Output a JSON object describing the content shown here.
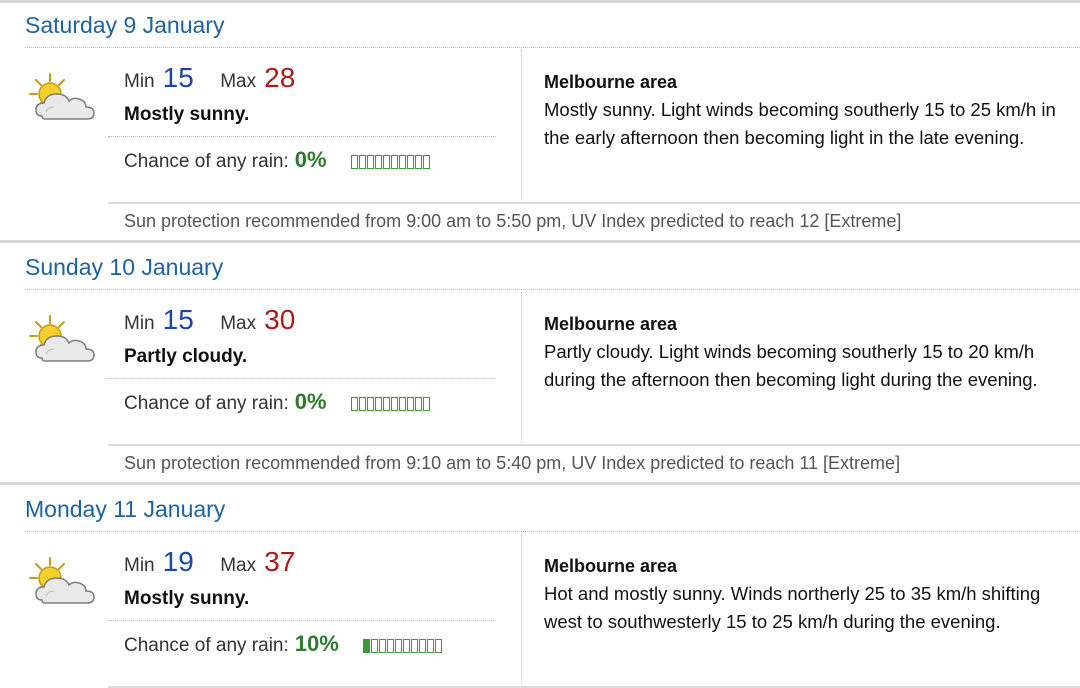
{
  "days": [
    {
      "heading": "Saturday 9 January",
      "min_label": "Min",
      "min": "15",
      "max_label": "Max",
      "max": "28",
      "summary": "Mostly sunny.",
      "rain_label": "Chance of any rain:",
      "rain_value": "0%",
      "rain_fraction": 0.0,
      "area_title": "Melbourne area",
      "area_text": "Mostly sunny. Light winds becoming southerly 15 to 25 km/h in the early afternoon then becoming light in the late evening.",
      "uv": "Sun protection recommended from 9:00 am to 5:50 pm, UV Index predicted to reach 12 [Extreme]",
      "icon": "partly-sunny-icon"
    },
    {
      "heading": "Sunday 10 January",
      "min_label": "Min",
      "min": "15",
      "max_label": "Max",
      "max": "30",
      "summary": "Partly cloudy.",
      "rain_label": "Chance of any rain:",
      "rain_value": "0%",
      "rain_fraction": 0.0,
      "area_title": "Melbourne area",
      "area_text": "Partly cloudy. Light winds becoming southerly 15 to 20 km/h during the afternoon then becoming light during the evening.",
      "uv": "Sun protection recommended from 9:10 am to 5:40 pm, UV Index predicted to reach 11 [Extreme]",
      "icon": "partly-sunny-icon"
    },
    {
      "heading": "Monday 11 January",
      "min_label": "Min",
      "min": "19",
      "max_label": "Max",
      "max": "37",
      "summary": "Mostly sunny.",
      "rain_label": "Chance of any rain:",
      "rain_value": "10%",
      "rain_fraction": 0.1,
      "area_title": "Melbourne area",
      "area_text": "Hot and mostly sunny. Winds northerly 25 to 35 km/h shifting west to southwesterly 15 to 25 km/h during the evening.",
      "icon": "partly-sunny-icon"
    }
  ],
  "colors": {
    "heading": "#1d63a4",
    "min": "#1747ad",
    "max": "#b01818",
    "rain": "#2d7a2d",
    "rain_box": "#3a9a3a"
  }
}
